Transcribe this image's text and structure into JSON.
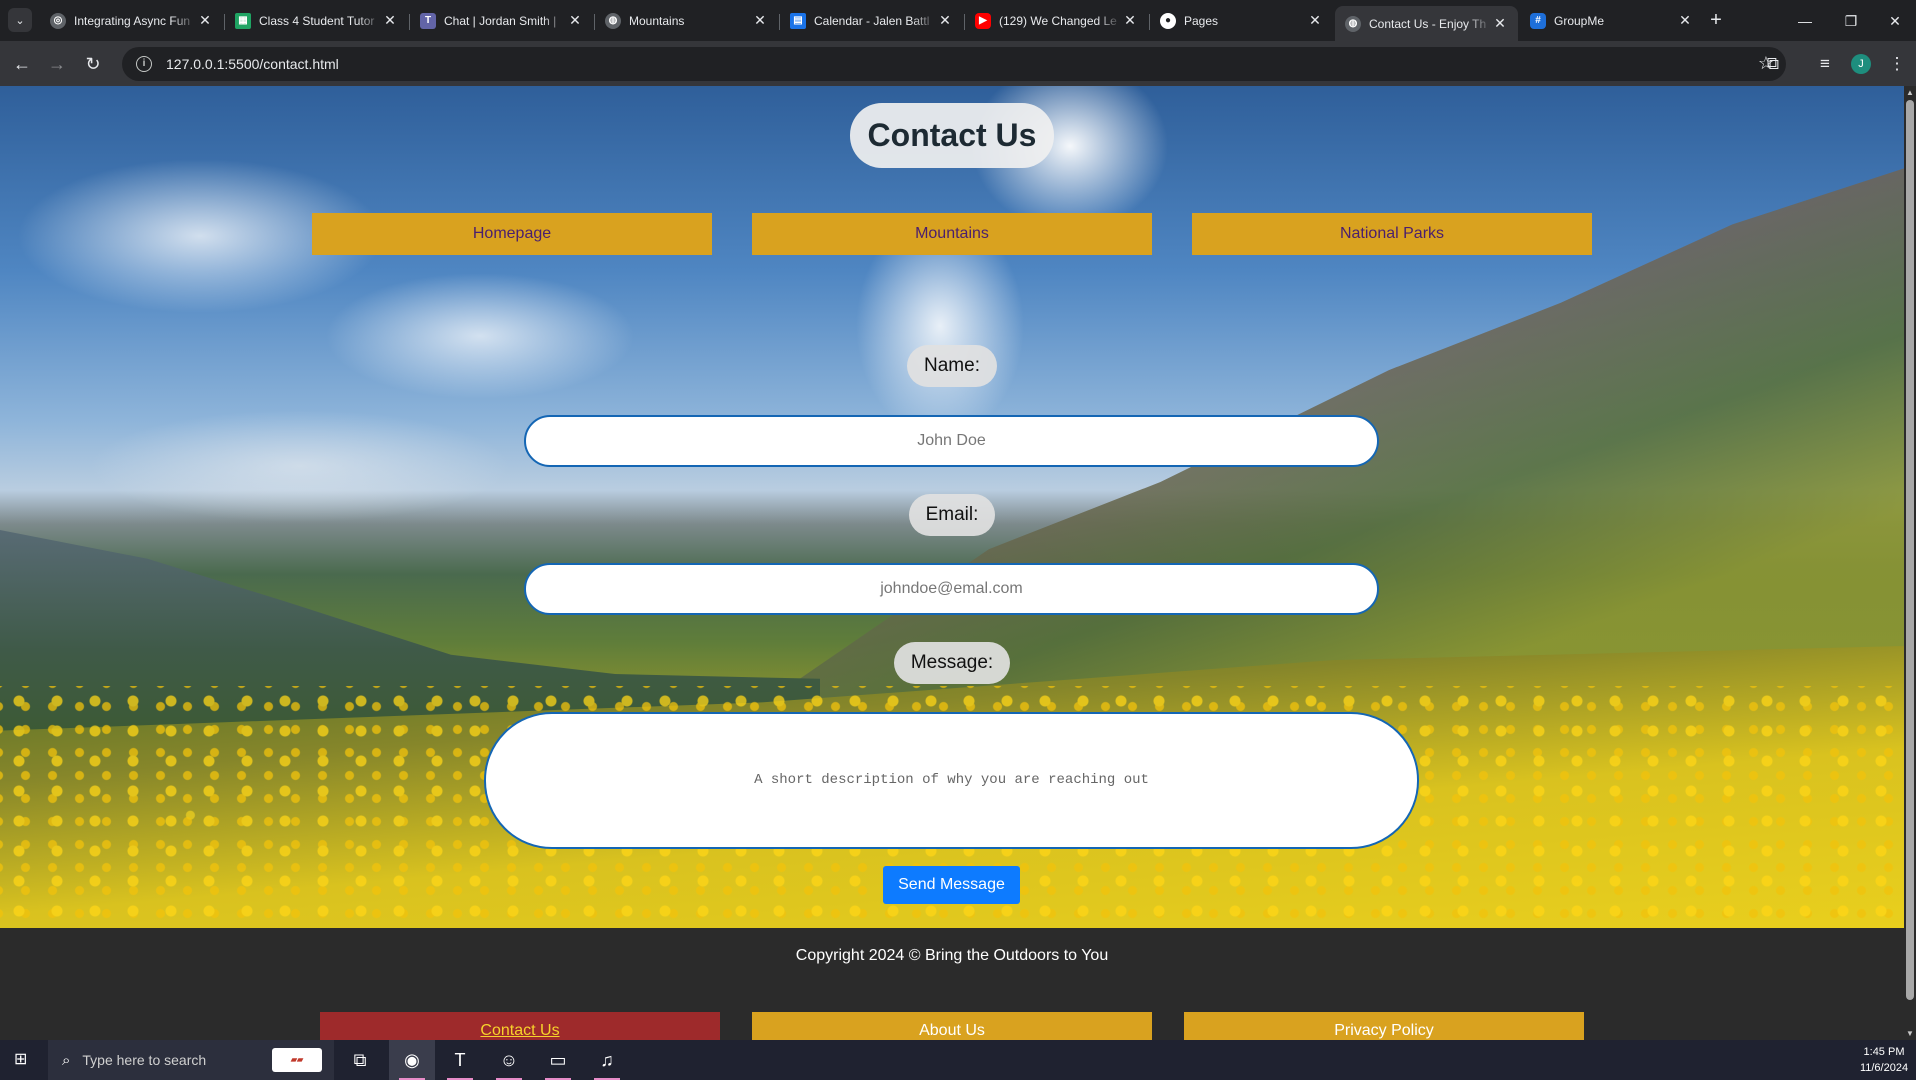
{
  "browser": {
    "tabs": [
      {
        "title": "Integrating Async Fun",
        "icon": "site-icon",
        "color": "#9aa0a6"
      },
      {
        "title": "Class 4 Student Tutor",
        "icon": "google-sheets-icon",
        "color": "#1fa463"
      },
      {
        "title": "Chat | Jordan Smith |",
        "icon": "teams-icon",
        "color": "#6264a7"
      },
      {
        "title": "Mountains",
        "icon": "globe-icon",
        "color": "#9aa0a6"
      },
      {
        "title": "Calendar - Jalen Battl",
        "icon": "calendar-icon",
        "color": "#1a73e8"
      },
      {
        "title": "(129) We Changed Le",
        "icon": "youtube-icon",
        "color": "#ff0000"
      },
      {
        "title": "Pages",
        "icon": "github-icon",
        "color": "#ffffff"
      },
      {
        "title": "Contact Us - Enjoy Th",
        "icon": "globe-icon",
        "color": "#9aa0a6",
        "active": true
      },
      {
        "title": "GroupMe",
        "icon": "groupme-icon",
        "color": "#1e6fd9"
      }
    ],
    "url": "127.0.0.1:5500/contact.html",
    "profile_initial": "J"
  },
  "page": {
    "title": "Contact Us",
    "nav": [
      "Homepage",
      "Mountains",
      "National Parks"
    ],
    "form": {
      "name_label": "Name:",
      "name_placeholder": "John Doe",
      "email_label": "Email:",
      "email_placeholder": "johndoe@emal.com",
      "message_label": "Message:",
      "message_placeholder": "A short description of why you are reaching out",
      "submit_label": "Send Message"
    },
    "footer": {
      "copyright": "Copyright 2024 © Bring the Outdoors to You",
      "links": [
        "Contact Us",
        "About Us",
        "Privacy Policy"
      ]
    }
  },
  "taskbar": {
    "search_placeholder": "Type here to search",
    "time": "1:45 PM",
    "date": "11/6/2024",
    "apps": [
      "task-view-icon",
      "chrome-icon",
      "teams-icon",
      "discord-icon",
      "twitch-icon",
      "itunes-icon"
    ]
  }
}
